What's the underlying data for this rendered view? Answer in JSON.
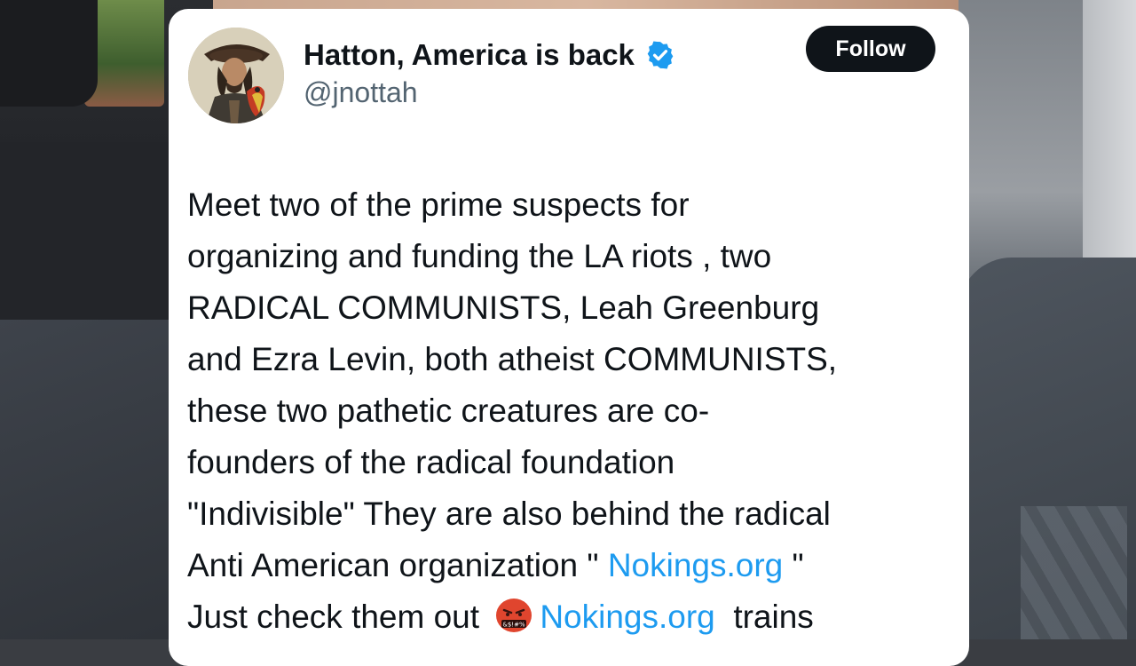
{
  "tweet": {
    "author": {
      "display_name": "Hatton, America is back",
      "handle": "@jnottah",
      "verified": true,
      "verified_icon": "verified-badge-icon",
      "avatar": "pirate-with-parrot-avatar"
    },
    "follow_label": "Follow",
    "body": {
      "line1": "Meet two of the prime suspects for",
      "line2": "organizing and funding the LA riots , two",
      "line3": "RADICAL COMMUNISTS,  Leah Greenburg",
      "line4": "and Ezra Levin,  both atheist COMMUNISTS,",
      "line5": "these two pathetic creatures are co-",
      "line6": "founders of the radical foundation",
      "line7": "\"Indivisible\" They are also behind the radical",
      "line8_before": "Anti American organization \" ",
      "line8_link": "Nokings.org",
      "line8_after": " \"",
      "line9_before": "Just check them out ",
      "line9_emoji": "cursing-face-emoji",
      "line9_link": "Nokings.org",
      "line9_after": "  trains"
    }
  },
  "colors": {
    "link": "#1d9bf0",
    "text": "#0f1419",
    "secondary": "#536471",
    "verified": "#1d9bf0",
    "follow_bg": "#0f1419"
  }
}
